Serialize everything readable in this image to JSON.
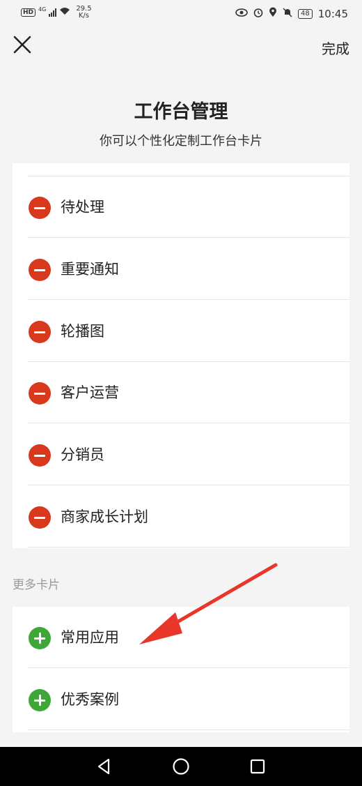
{
  "status_bar": {
    "hd": "HD",
    "network": "4G",
    "speed_value": "29.5",
    "speed_unit": "K/s",
    "battery": "48",
    "time": "10:45"
  },
  "header": {
    "done_label": "完成",
    "title": "工作台管理",
    "subtitle": "你可以个性化定制工作台卡片"
  },
  "active_cards": [
    {
      "label": "待处理"
    },
    {
      "label": "重要通知"
    },
    {
      "label": "轮播图"
    },
    {
      "label": "客户运营"
    },
    {
      "label": "分销员"
    },
    {
      "label": "商家成长计划"
    }
  ],
  "more_section": {
    "title": "更多卡片",
    "items": [
      {
        "label": "常用应用"
      },
      {
        "label": "优秀案例"
      }
    ]
  },
  "colors": {
    "remove": "#d8381c",
    "add": "#3da737",
    "arrow": "#e8362a"
  },
  "icons": {
    "close": "close-icon",
    "remove": "minus-circle-icon",
    "add": "plus-circle-icon",
    "back": "back-triangle-icon",
    "home": "home-circle-icon",
    "recents": "recents-square-icon"
  }
}
